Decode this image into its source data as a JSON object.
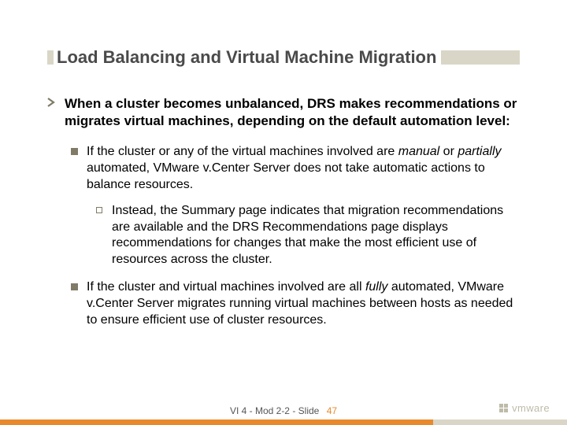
{
  "slide": {
    "title": "Load Balancing and Virtual Machine Migration",
    "level1": {
      "text": "When a cluster becomes unbalanced, DRS makes recommendations or migrates virtual machines, depending on the default automation level:"
    },
    "level2a": {
      "pre": "If the cluster or any of the virtual machines involved are ",
      "em1": "manual",
      "mid": " or ",
      "em2": "partially",
      "post": " automated, VMware v.Center Server does not take automatic actions to balance resources."
    },
    "level3": {
      "text": "Instead, the Summary page indicates that migration recommendations are available and the DRS Recommendations page displays recommendations for changes that make the most efficient use of resources across the cluster."
    },
    "level2b": {
      "pre": "If the cluster and virtual machines involved are all ",
      "em1": "fully",
      "post": " automated, VMware v.Center Server migrates running virtual machines between hosts as needed to ensure efficient use of cluster resources."
    }
  },
  "footer": {
    "label": "VI 4 - Mod 2-2 - Slide",
    "number": "47",
    "logo": "vmware"
  }
}
